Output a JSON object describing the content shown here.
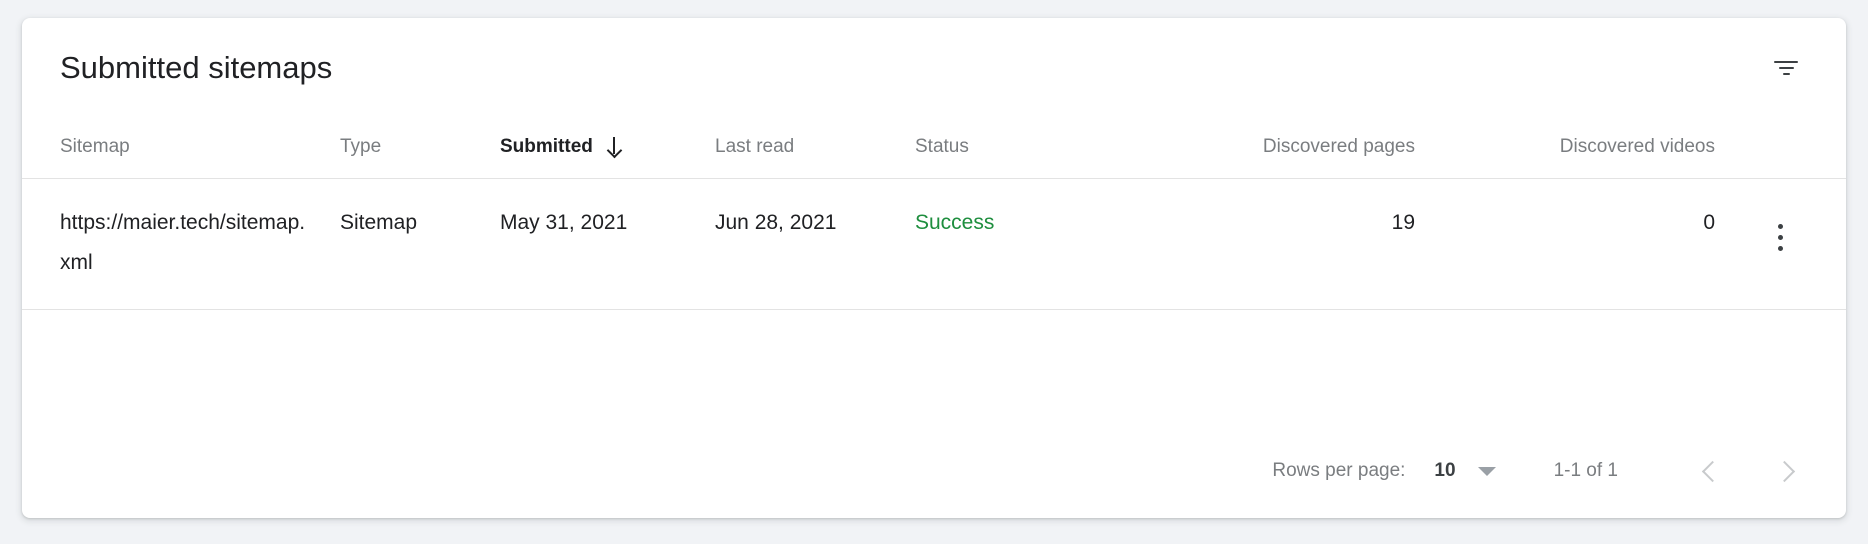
{
  "card": {
    "title": "Submitted sitemaps",
    "filter_icon": "filter-funnel-icon"
  },
  "table": {
    "columns": [
      {
        "label": "Sitemap",
        "align": "left",
        "sorted": false
      },
      {
        "label": "Type",
        "align": "left",
        "sorted": false
      },
      {
        "label": "Submitted",
        "align": "left",
        "sorted": true,
        "sort_direction": "descending",
        "sort_icon": "arrow-down-icon"
      },
      {
        "label": "Last read",
        "align": "left",
        "sorted": false
      },
      {
        "label": "Status",
        "align": "left",
        "sorted": false
      },
      {
        "label": "Discovered pages",
        "align": "right",
        "sorted": false
      },
      {
        "label": "Discovered videos",
        "align": "right",
        "sorted": false
      }
    ],
    "rows": [
      {
        "sitemap": "https://maier.tech/sitemap.xml",
        "type": "Sitemap",
        "submitted": "May 31, 2021",
        "last_read": "Jun 28, 2021",
        "status": "Success",
        "status_color": "#1e8e3e",
        "discovered_pages": "19",
        "discovered_videos": "0",
        "menu_icon": "more-vert-icon"
      }
    ]
  },
  "footer": {
    "rows_per_page_label": "Rows per page:",
    "rows_per_page_value": "10",
    "rows_per_page_caret": "chevron-down-icon",
    "range_label": "1-1 of 1",
    "prev_icon": "chevron-left-icon",
    "next_icon": "chevron-right-icon"
  }
}
